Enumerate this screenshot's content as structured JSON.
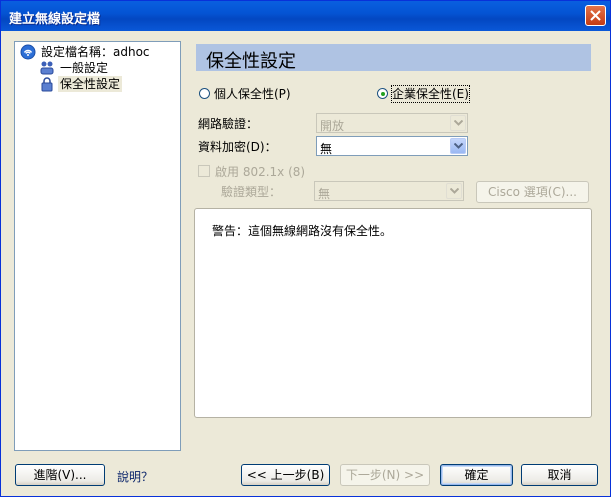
{
  "window": {
    "title": "建立無線設定檔"
  },
  "tree": {
    "items": [
      {
        "label": "設定檔名稱：adhoc",
        "icon": "wireless-profile-icon"
      },
      {
        "label": "一般設定",
        "icon": "network-users-icon"
      },
      {
        "label": "保全性設定",
        "icon": "lock-icon",
        "selected": true
      }
    ]
  },
  "security": {
    "heading": "保全性設定",
    "personal_label": "個人保全性(P)",
    "enterprise_label": "企業保全性(E)",
    "selected_option": "enterprise",
    "auth_label": "網路驗證：",
    "auth_value": "開放",
    "encrypt_label": "資料加密(D)：",
    "encrypt_value": "無",
    "enable_8021x_label": "啟用 802.1x (8)",
    "auth_type_label": "驗證類型：",
    "auth_type_value": "無",
    "cisco_button": "Cisco 選項(C)...",
    "warning": "警告：這個無線網路沒有保全性。"
  },
  "footer": {
    "advanced_button": "進階(V)...",
    "help_link": "說明？",
    "back_button": "<< 上一步(B)",
    "next_button": "下一步(N) >>",
    "ok_button": "確定",
    "cancel_button": "取消"
  },
  "colors": {
    "title_bar": "#0454d4",
    "section_header": "#afc3e3",
    "radio_selected": "#21a121"
  }
}
